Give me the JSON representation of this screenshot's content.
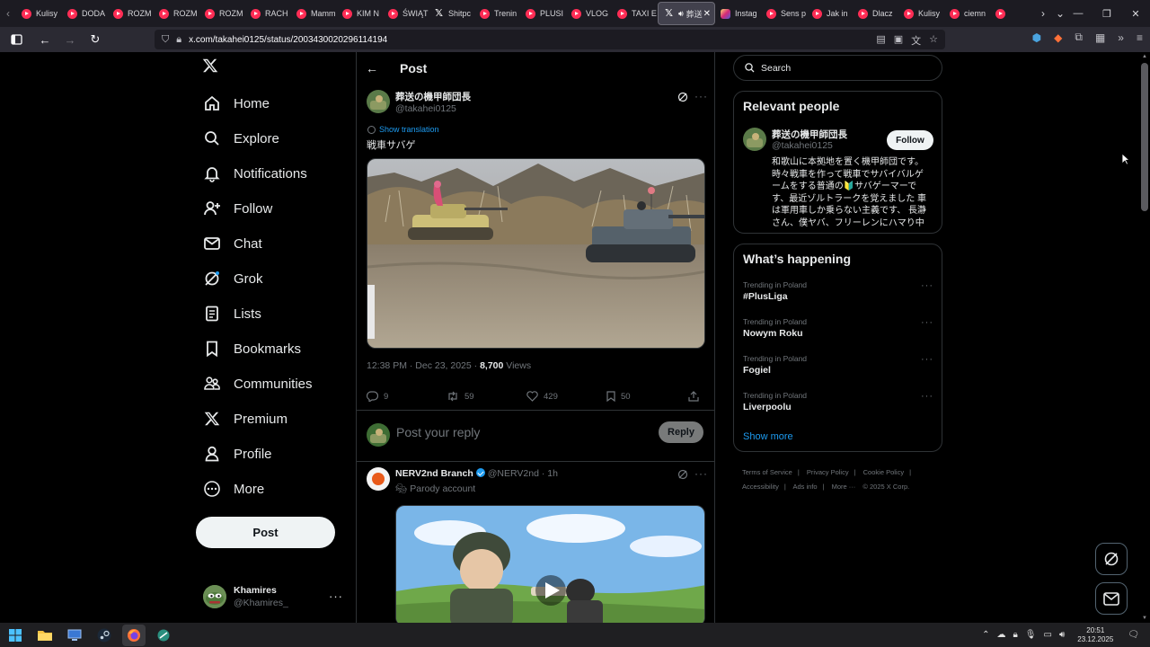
{
  "browser": {
    "tabs": [
      {
        "label": "Kulisy",
        "icon": "youtube-icon"
      },
      {
        "label": "DODA",
        "icon": "youtube-icon"
      },
      {
        "label": "ROZM",
        "icon": "youtube-icon"
      },
      {
        "label": "ROZM",
        "icon": "youtube-icon"
      },
      {
        "label": "ROZM",
        "icon": "youtube-icon"
      },
      {
        "label": "RACH",
        "icon": "youtube-icon"
      },
      {
        "label": "Mamm",
        "icon": "youtube-icon"
      },
      {
        "label": "KIM N",
        "icon": "youtube-icon"
      },
      {
        "label": "ŚWIĄT",
        "icon": "youtube-icon"
      },
      {
        "label": "Shitpc",
        "icon": "x-icon"
      },
      {
        "label": "Trenin",
        "icon": "youtube-icon"
      },
      {
        "label": "PLUSI",
        "icon": "youtube-icon"
      },
      {
        "label": "VLOG",
        "icon": "youtube-icon"
      },
      {
        "label": "TAXI E",
        "icon": "youtube-icon"
      },
      {
        "label": "葬送",
        "icon": "x-icon",
        "active": true
      },
      {
        "label": "Instag",
        "icon": "instagram-icon"
      },
      {
        "label": "Sens p",
        "icon": "youtube-icon"
      },
      {
        "label": "Jak in",
        "icon": "youtube-icon"
      },
      {
        "label": "Dlacz",
        "icon": "youtube-icon"
      },
      {
        "label": "Kulisy",
        "icon": "youtube-icon"
      },
      {
        "label": "ciemn",
        "icon": "youtube-icon"
      },
      {
        "label": "",
        "icon": "youtube-icon"
      }
    ],
    "url": "x.com/takahei0125/status/2003430020296114194"
  },
  "nav": {
    "items": [
      {
        "label": "Home",
        "icon": "home-icon"
      },
      {
        "label": "Explore",
        "icon": "search-icon"
      },
      {
        "label": "Notifications",
        "icon": "bell-icon"
      },
      {
        "label": "Follow",
        "icon": "follow-icon"
      },
      {
        "label": "Chat",
        "icon": "mail-icon"
      },
      {
        "label": "Grok",
        "icon": "grok-icon"
      },
      {
        "label": "Lists",
        "icon": "lists-icon"
      },
      {
        "label": "Bookmarks",
        "icon": "bookmark-icon"
      },
      {
        "label": "Communities",
        "icon": "communities-icon"
      },
      {
        "label": "Premium",
        "icon": "x-icon"
      },
      {
        "label": "Profile",
        "icon": "profile-icon"
      },
      {
        "label": "More",
        "icon": "more-icon"
      }
    ],
    "post_label": "Post",
    "account": {
      "name": "Khamires",
      "handle": "@Khamires_"
    }
  },
  "post": {
    "header_title": "Post",
    "author_name": "葬送の機甲師団長",
    "author_handle": "@takahei0125",
    "show_translation": "Show translation",
    "text": "戦車サバゲ",
    "time": "12:38 PM · Dec 23, 2025 · ",
    "views_count": "8,700",
    "views_label": " Views",
    "replies": "9",
    "reposts": "59",
    "likes": "429",
    "bookmarks": "50",
    "reply_placeholder": "Post your reply",
    "reply_button": "Reply"
  },
  "reply": {
    "name": "NERV2nd Branch",
    "handle": "@NERV2nd",
    "time": " · 1h",
    "parody": "Parody account"
  },
  "sidebar": {
    "search_placeholder": "Search",
    "relevant_title": "Relevant people",
    "person_name": "葬送の機甲師団長",
    "person_handle": "@takahei0125",
    "follow_label": "Follow",
    "person_bio": "和歌山に本拠地を置く機甲師団です。時々戦車を作って戦車でサバイバルゲームをする普通の🔰サバゲーマーです、最近ゾルトラークを覚えました 車は軍用車しか乗らない主義です、 長瀞さん、僕ヤバ、フリーレンにハマり中",
    "happening_title": "What’s happening",
    "trends": [
      {
        "context": "Trending in Poland",
        "name": "#PlusLiga"
      },
      {
        "context": "Trending in Poland",
        "name": "Nowym Roku"
      },
      {
        "context": "Trending in Poland",
        "name": "Fogiel"
      },
      {
        "context": "Trending in Poland",
        "name": "Liverpoolu"
      }
    ],
    "show_more": "Show more",
    "footer": [
      "Terms of Service",
      "Privacy Policy",
      "Cookie Policy",
      "Accessibility",
      "Ads info",
      "More ···",
      "© 2025 X Corp."
    ]
  },
  "taskbar": {
    "time": "20:51",
    "date": "23.12.2025"
  },
  "colors": {
    "accent": "#1d9bf0",
    "background": "#000000",
    "youtube": "#ff2d55"
  }
}
